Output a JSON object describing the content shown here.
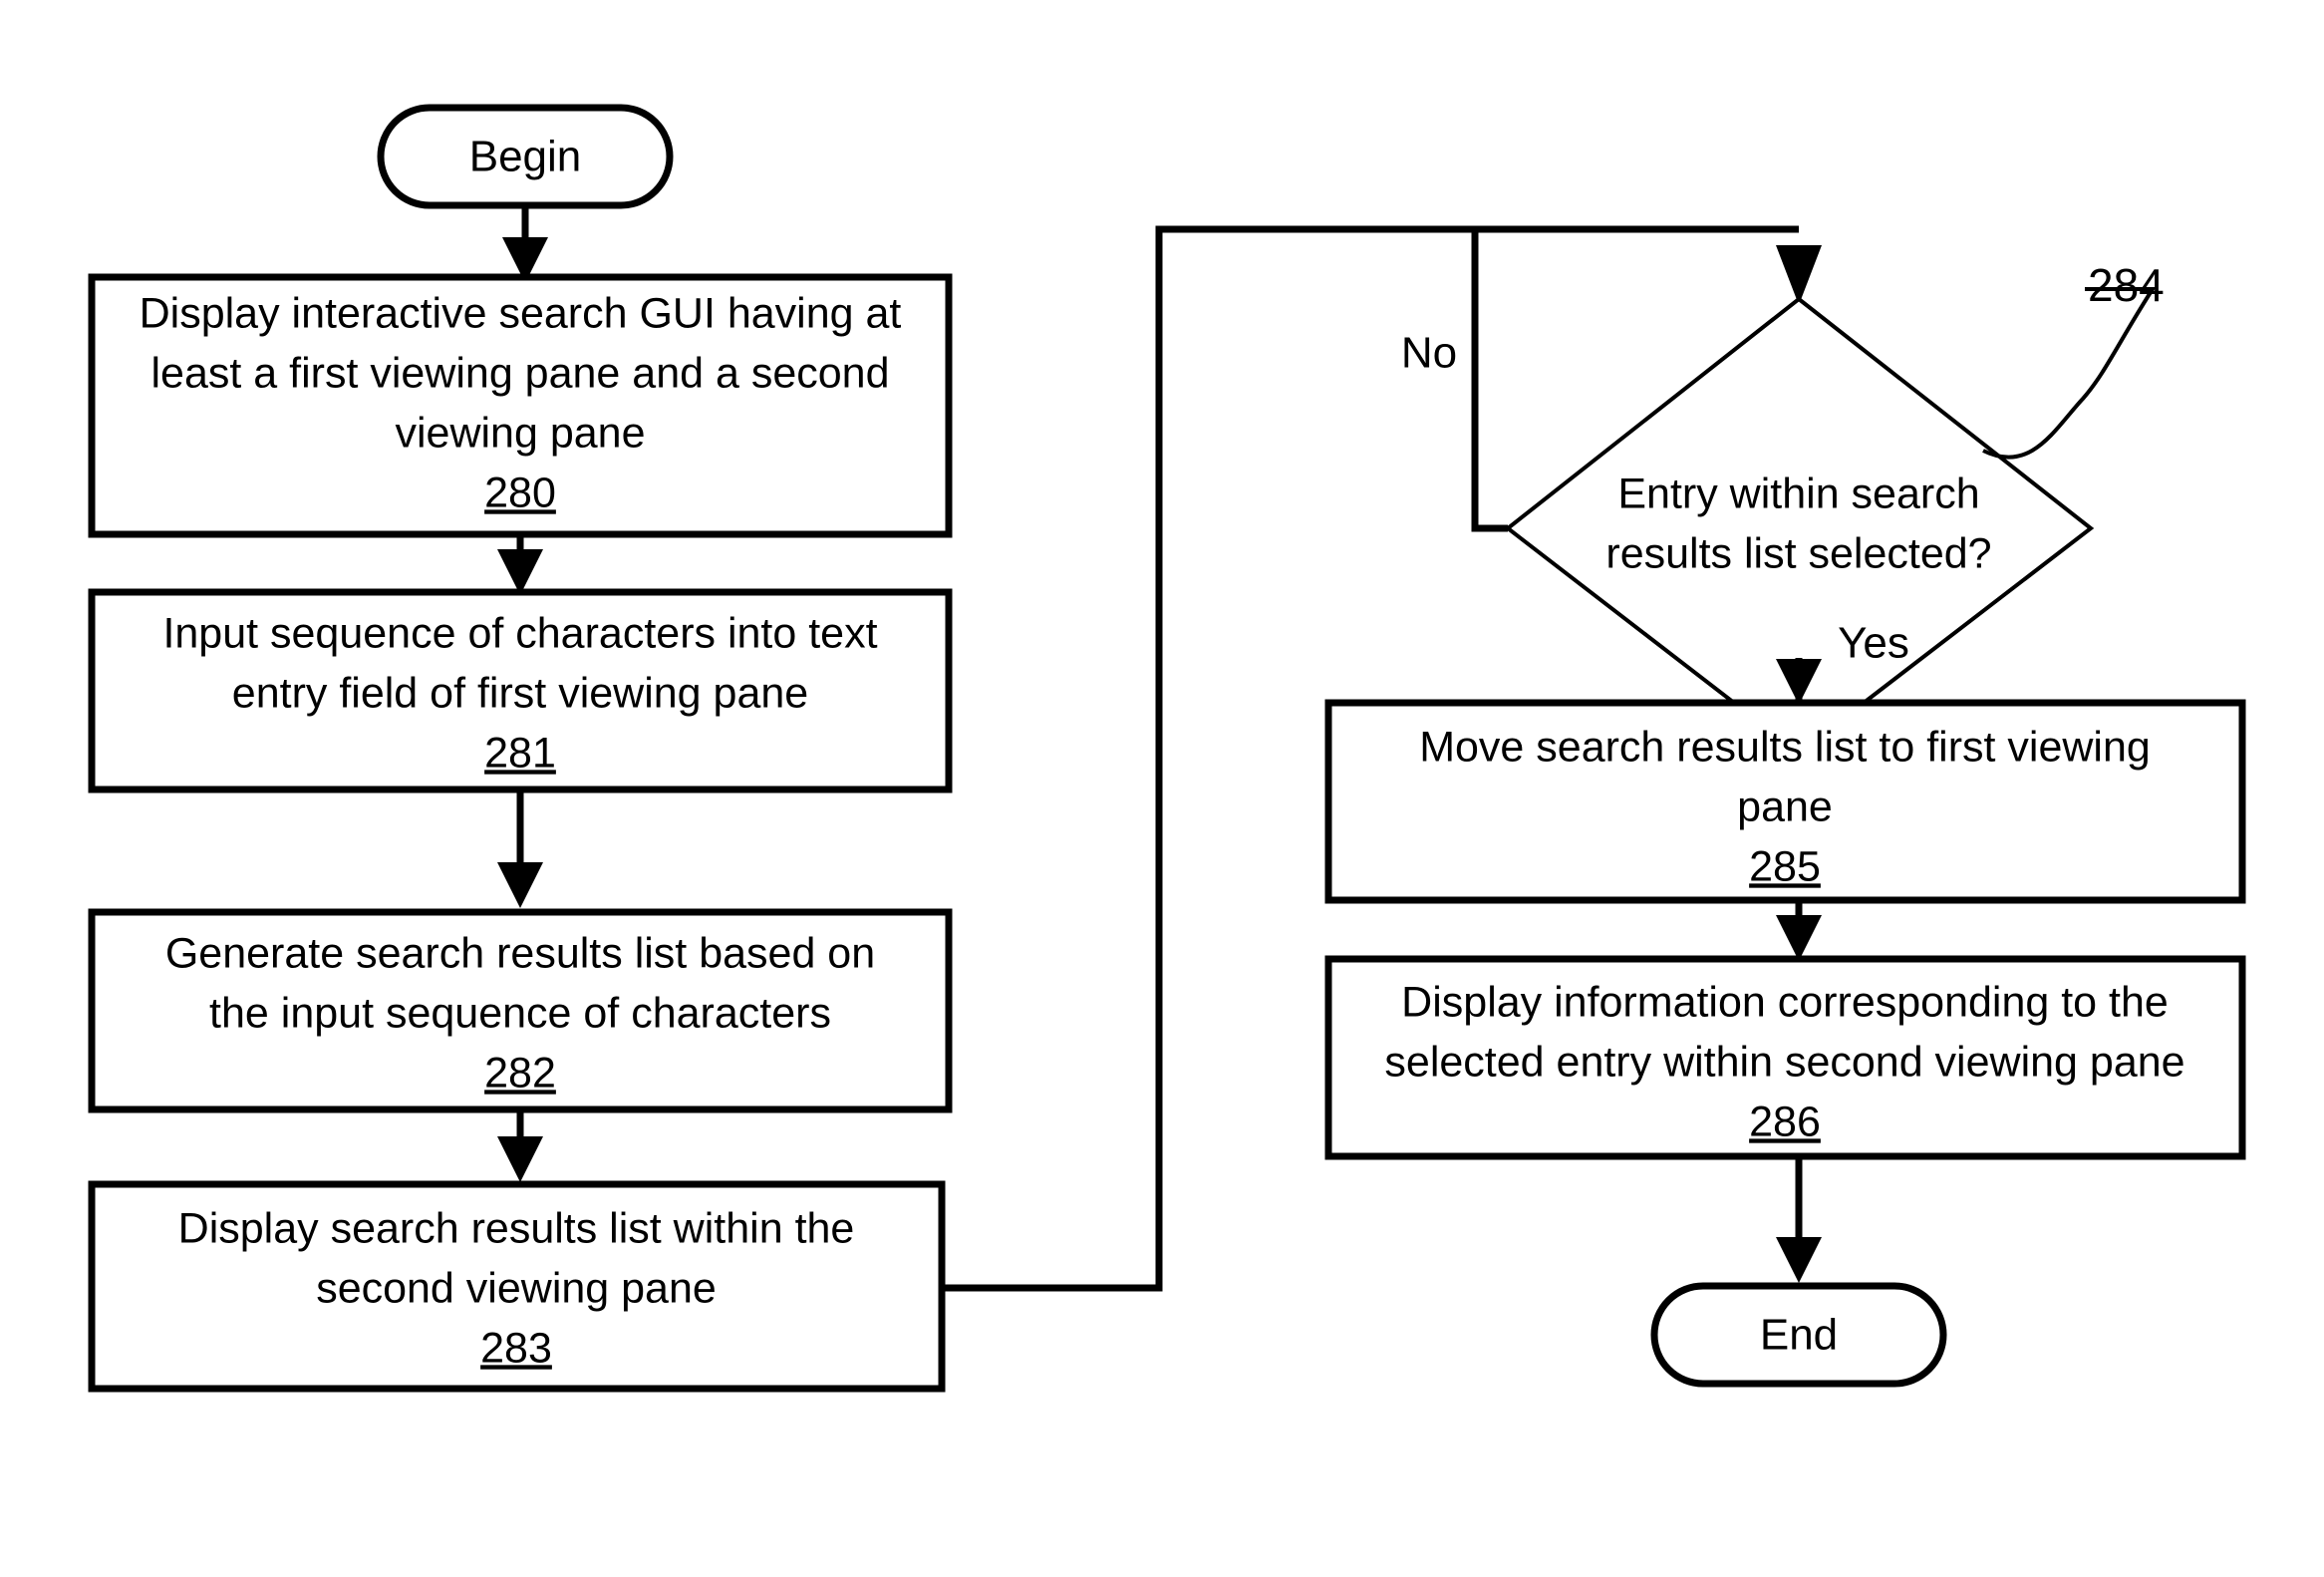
{
  "diagram": {
    "type": "flowchart",
    "title": "Interactive search GUI process flowchart",
    "nodes": {
      "begin": {
        "shape": "terminator",
        "label": "Begin"
      },
      "step280": {
        "shape": "process",
        "line1": "Display interactive search GUI having at",
        "line2": "least a first viewing pane and a second",
        "line3": "viewing pane",
        "ref": "280"
      },
      "step281": {
        "shape": "process",
        "line1": "Input sequence of characters into text",
        "line2": "entry field of first viewing pane",
        "ref": "281"
      },
      "step282": {
        "shape": "process",
        "line1": "Generate search results list based on",
        "line2": "the input sequence of characters",
        "ref": "282"
      },
      "step283": {
        "shape": "process",
        "line1": "Display search results list within the",
        "line2": "second viewing pane",
        "ref": "283"
      },
      "decision284": {
        "shape": "decision",
        "line1": "Entry within search",
        "line2": "results list selected?",
        "ref": "284"
      },
      "step285": {
        "shape": "process",
        "line1": "Move search results list to first viewing",
        "line2": "pane",
        "ref": "285"
      },
      "step286": {
        "shape": "process",
        "line1": "Display information corresponding to the",
        "line2": "selected entry within second viewing pane",
        "ref": "286"
      },
      "end": {
        "shape": "terminator",
        "label": "End"
      }
    },
    "branch_labels": {
      "no": "No",
      "yes": "Yes"
    },
    "colors": {
      "stroke": "#000000",
      "fill": "#ffffff",
      "text": "#000000"
    }
  }
}
